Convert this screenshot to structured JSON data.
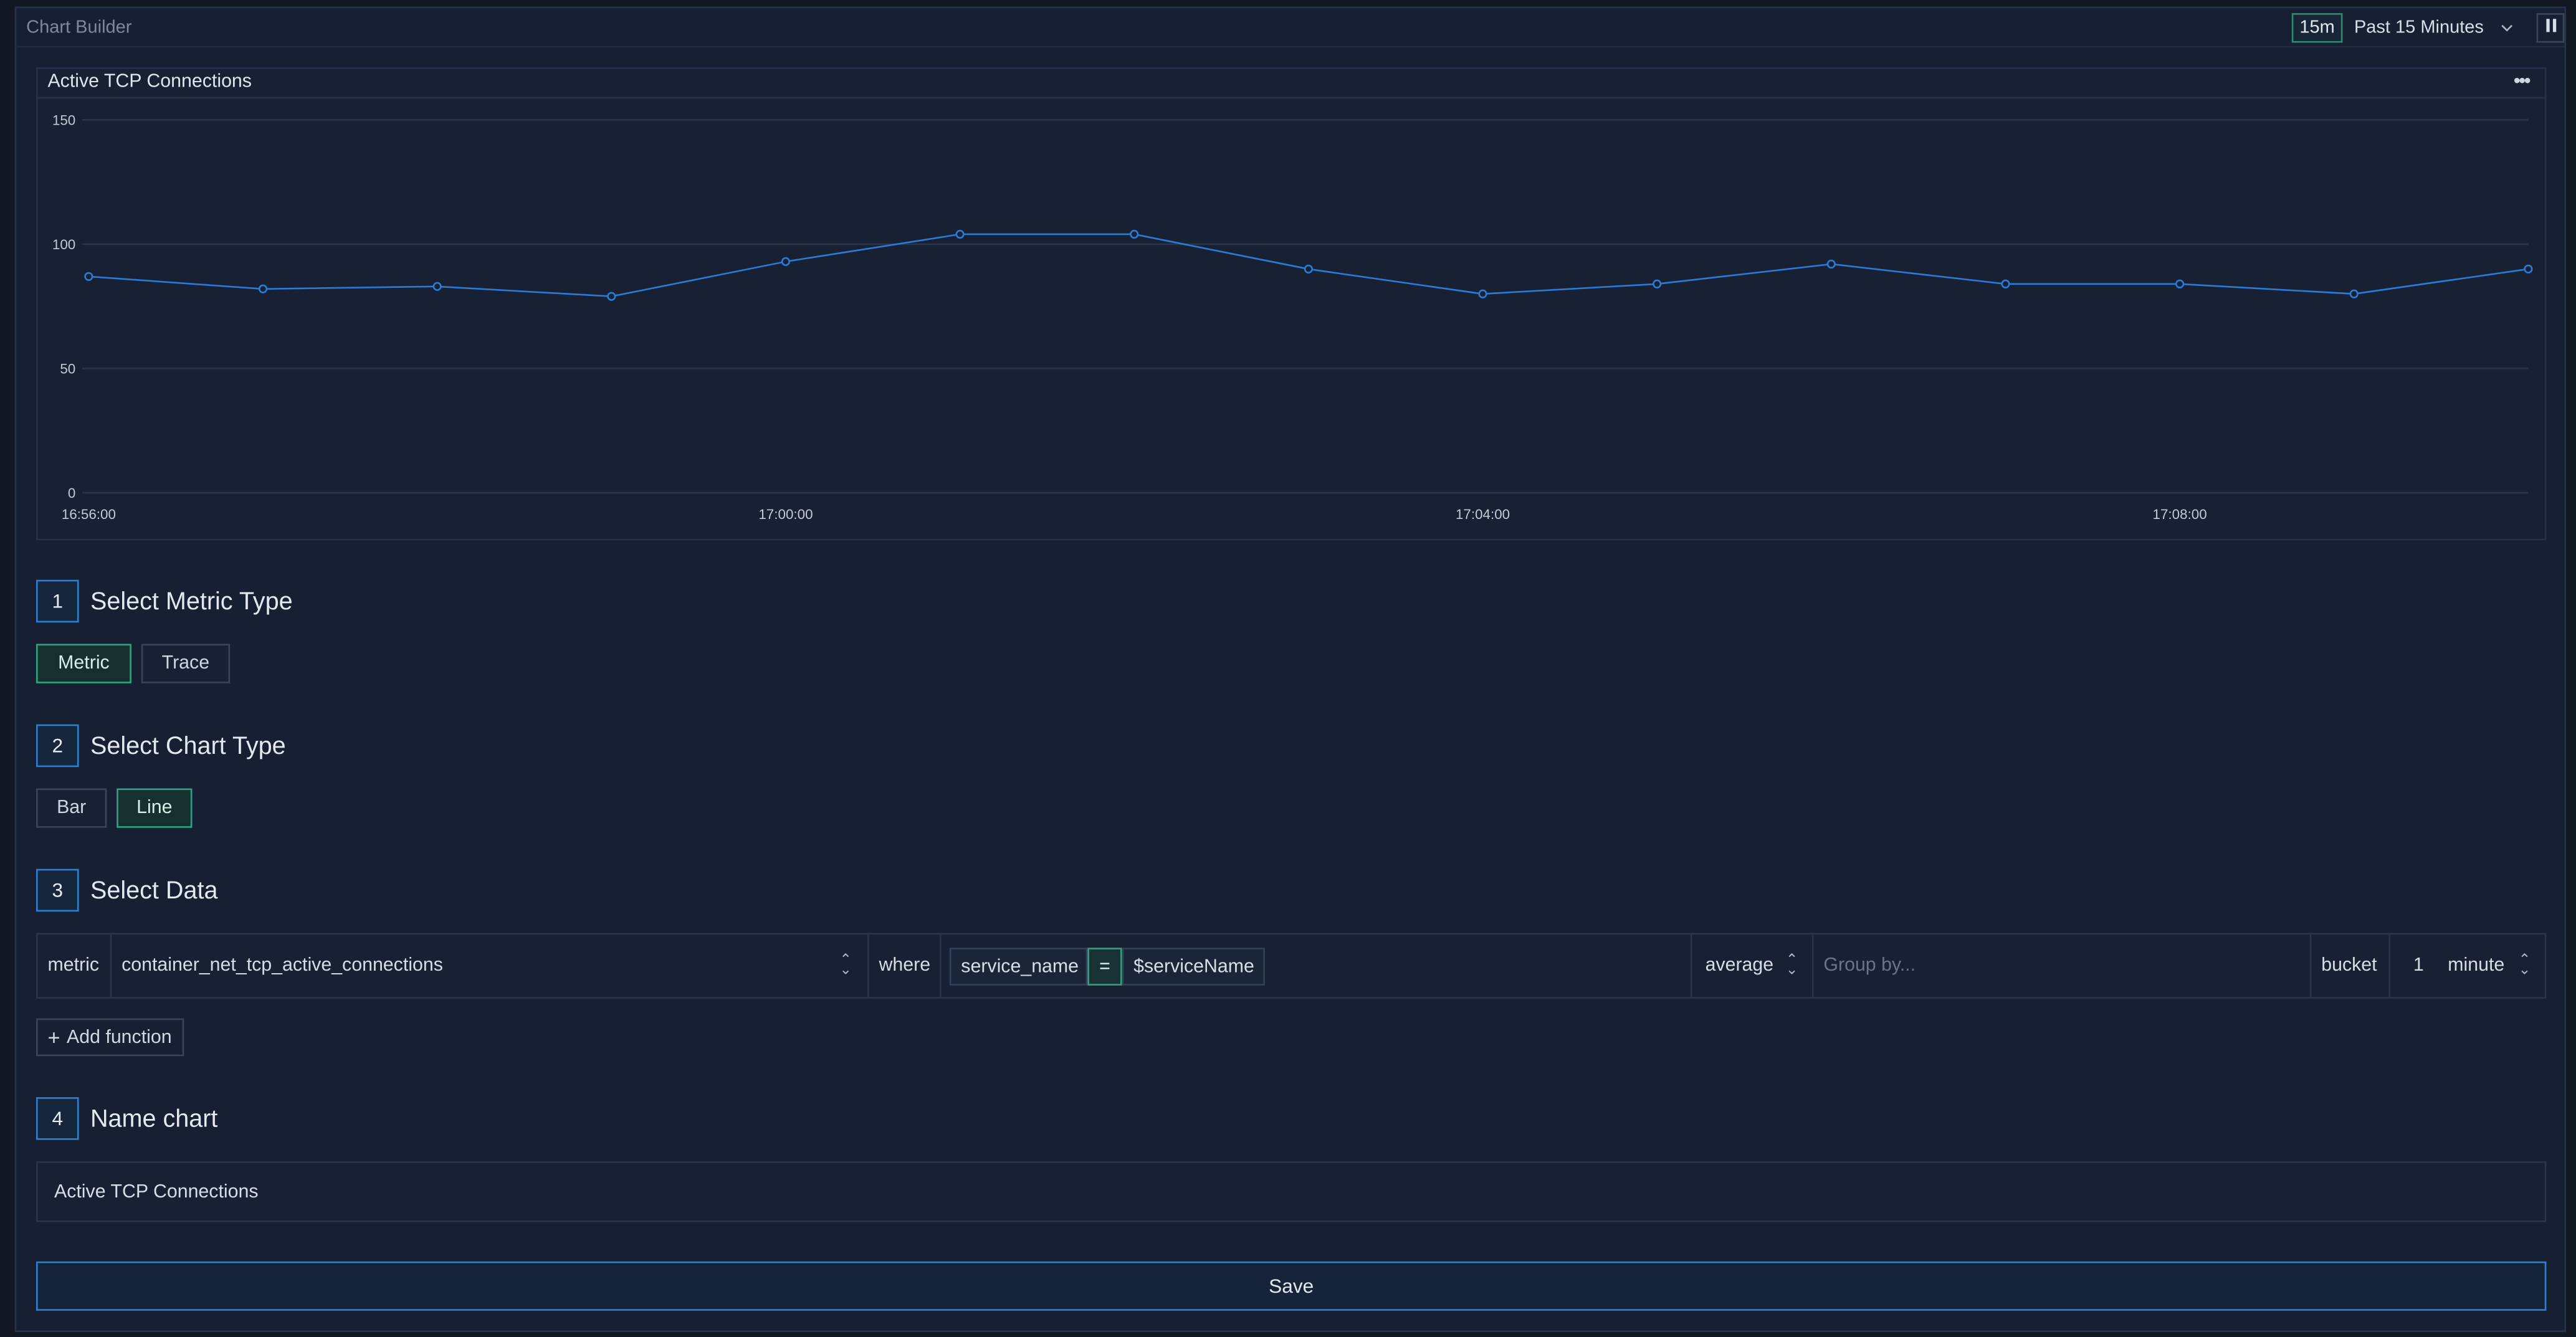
{
  "header": {
    "title": "Chart Builder",
    "time_short": "15m",
    "time_range": "Past 15 Minutes",
    "pause_icon": "pause-icon"
  },
  "chart_card": {
    "title": "Active TCP Connections",
    "menu_icon": "more-horizontal-icon"
  },
  "chart_data": {
    "type": "line",
    "title": "Active TCP Connections",
    "xlabel": "",
    "ylabel": "",
    "x_tick_labels": [
      "16:56:00",
      "17:00:00",
      "17:04:00",
      "17:08:00"
    ],
    "y_ticks": [
      0,
      50,
      100,
      150
    ],
    "ylim": [
      0,
      150
    ],
    "grid": true,
    "legend": "none",
    "color": "#2b7bd6",
    "series": [
      {
        "x": [
          "16:56:00",
          "16:57:00",
          "16:58:00",
          "16:59:00",
          "17:00:00",
          "17:01:00",
          "17:02:00",
          "17:03:00",
          "17:04:00",
          "17:05:00",
          "17:06:00",
          "17:07:00",
          "17:08:00",
          "17:09:00",
          "17:10:00"
        ],
        "values": [
          87,
          82,
          83,
          79,
          93,
          104,
          104,
          90,
          80,
          84,
          92,
          84,
          84,
          80,
          90
        ]
      }
    ]
  },
  "steps": [
    {
      "num": "1",
      "label": "Select Metric Type"
    },
    {
      "num": "2",
      "label": "Select Chart Type"
    },
    {
      "num": "3",
      "label": "Select Data"
    },
    {
      "num": "4",
      "label": "Name chart"
    }
  ],
  "metric_type": {
    "options": [
      "Metric",
      "Trace"
    ],
    "selected": "Metric"
  },
  "chart_type": {
    "options": [
      "Bar",
      "Line"
    ],
    "selected": "Line"
  },
  "query": {
    "metric_label": "metric",
    "metric_value": "container_net_tcp_active_connections",
    "where_label": "where",
    "filter_key": "service_name",
    "filter_op": "=",
    "filter_value": "$serviceName",
    "aggregation": "average",
    "group_by_placeholder": "Group by...",
    "bucket_label": "bucket",
    "bucket_size": "1",
    "bucket_unit": "minute"
  },
  "add_function_label": "Add function",
  "chart_name_value": "Active TCP Connections",
  "save_label": "Save"
}
